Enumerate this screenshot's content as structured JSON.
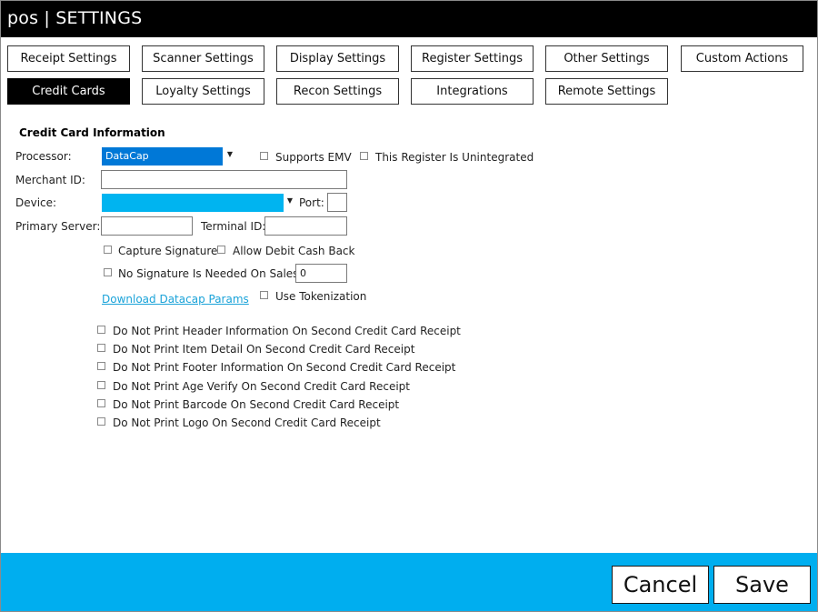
{
  "window": {
    "title": "pos | SETTINGS"
  },
  "tabs_row1": [
    "Receipt Settings",
    "Scanner Settings",
    "Display Settings",
    "Register Settings",
    "Other Settings",
    "Custom Actions"
  ],
  "tabs_row2": [
    "Credit Cards",
    "Loyalty Settings",
    "Recon Settings",
    "Integrations",
    "Remote Settings"
  ],
  "active_tab": "Credit Cards",
  "section": {
    "title": "Credit Card Information"
  },
  "form": {
    "processor_label": "Processor:",
    "processor_value": "DataCap",
    "supports_emv": "Supports EMV",
    "unintegrated": "This Register Is Unintegrated",
    "merchant_label": "Merchant ID:",
    "merchant_value": "",
    "device_label": "Device:",
    "device_value": "",
    "port_label": "Port:",
    "port_value": "",
    "primary_server_label": "Primary Server:",
    "primary_server_value": "",
    "terminal_label": "Terminal ID:",
    "terminal_value": "",
    "capture_signature": "Capture Signature",
    "allow_debit": "Allow Debit Cash Back",
    "no_signature": "No Signature Is Needed On Sales <",
    "no_signature_value": "0",
    "download_link": "Download Datacap Params",
    "use_tokenization": "Use Tokenization"
  },
  "receipt_options": [
    "Do Not Print Header Information On Second Credit Card Receipt",
    "Do Not Print Item Detail On Second Credit Card Receipt",
    "Do Not Print Footer Information On Second Credit Card Receipt",
    "Do Not Print Age Verify On Second Credit Card Receipt",
    "Do Not Print Barcode On Second Credit Card Receipt",
    "Do Not Print Logo On Second Credit Card Receipt"
  ],
  "footer": {
    "cancel_label": "Cancel",
    "save_label": "Save"
  },
  "colors": {
    "titlebar": "#000000",
    "footer": "#00aeef",
    "processor_select": "#0078d7",
    "device_select": "#00b4f0",
    "link": "#1aa3d9"
  }
}
